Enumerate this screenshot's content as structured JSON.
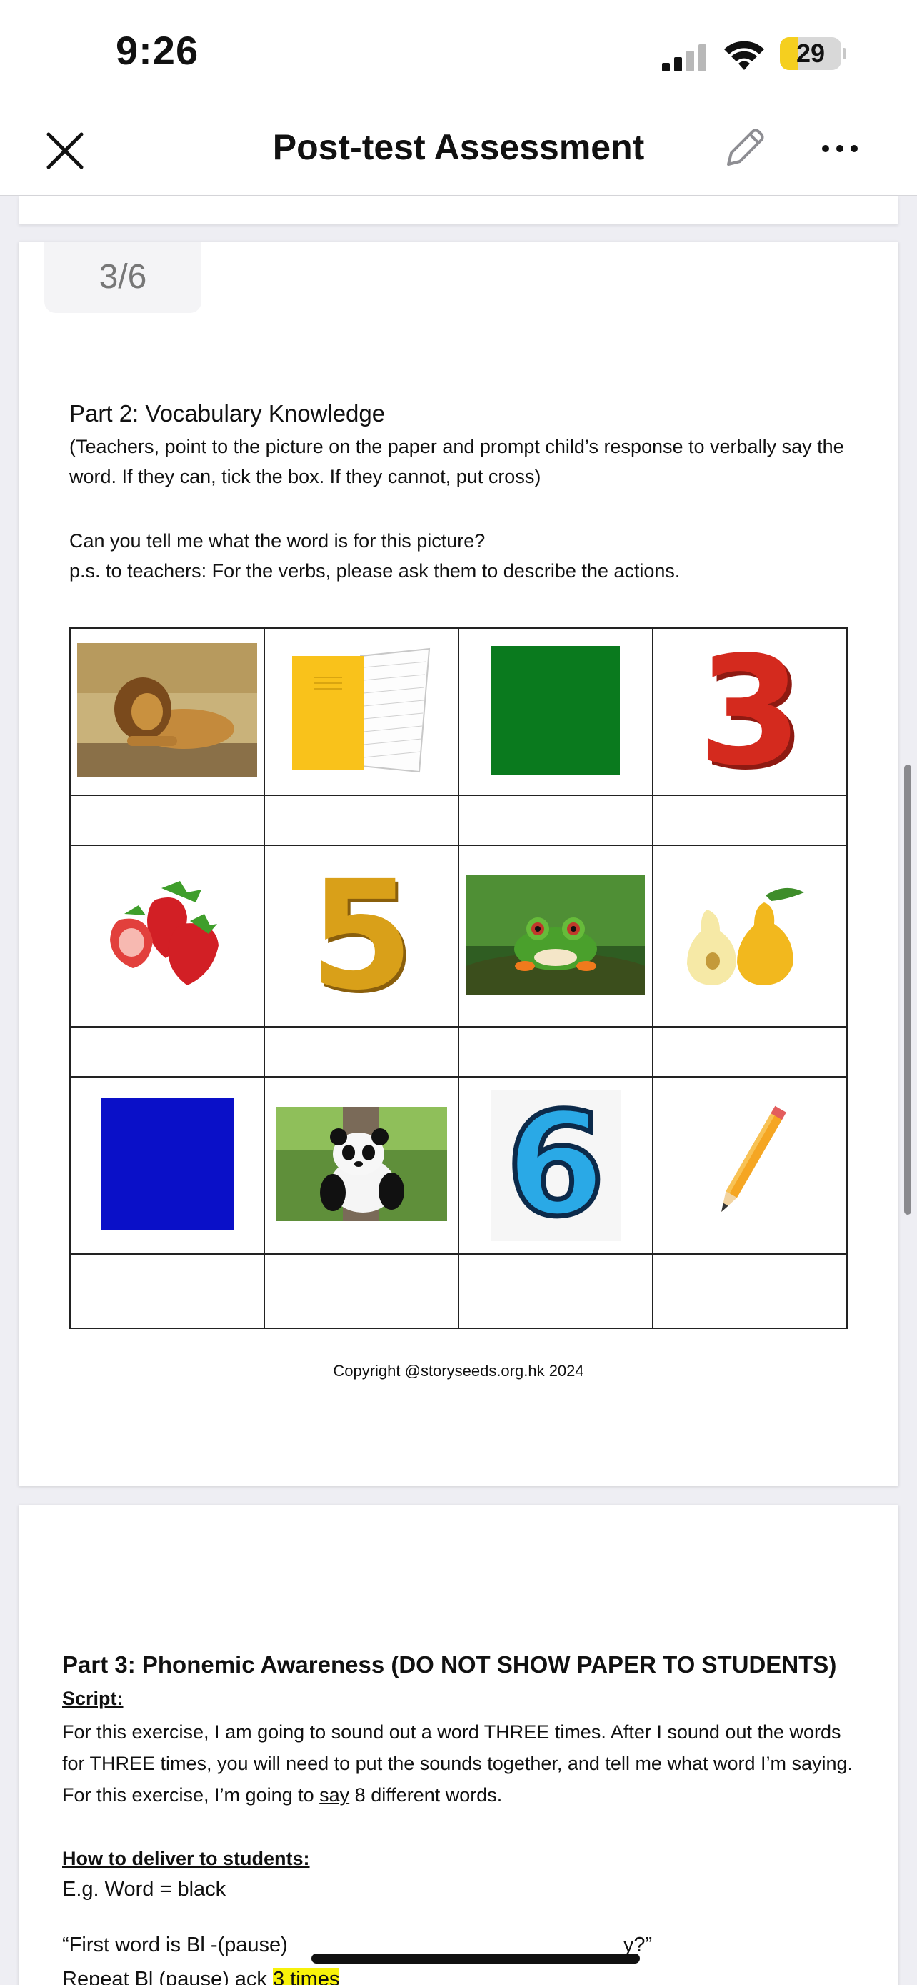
{
  "status_bar": {
    "time": "9:26",
    "battery_level": "29",
    "battery_fraction": 0.29,
    "icons": [
      "cellular-signal-icon",
      "wifi-icon",
      "battery-icon"
    ]
  },
  "nav": {
    "title": "Post-test Assessment",
    "icons": [
      "close-icon",
      "pencil-edit-icon",
      "more-ellipsis-icon"
    ]
  },
  "document": {
    "page_indicator": "3/6",
    "part2": {
      "title": "Part 2: Vocabulary Knowledge",
      "instructions": "(Teachers, point to the picture on the paper and prompt child’s response to verbally say the word. If they can, tick the box. If they cannot, put cross)",
      "question": "Can you tell me what the word is for this picture?",
      "note": "p.s. to teachers: For the verbs, please ask them to describe the actions.",
      "pictures": [
        [
          "lion",
          "yellow-notebook",
          "green-square",
          "number-3"
        ],
        [
          "strawberries",
          "number-5",
          "frog",
          "pears"
        ],
        [
          "blue-square",
          "panda",
          "number-6",
          "pencil"
        ]
      ],
      "picture_text": {
        "three": "3",
        "five": "5",
        "six": "6"
      }
    },
    "copyright": "Copyright @storyseeds.org.hk 2024",
    "part3": {
      "title": "Part 3: Phonemic Awareness (DO NOT SHOW PAPER TO STUDENTS)",
      "script_label": "Script:",
      "body_1": "For this exercise, I am going to sound out a word THREE times. After I sound out the words for THREE times, you will need to put the sounds together, and tell me what word I’m saying. For this exercise, I’m going to ",
      "body_underlined": "say",
      "body_2": " 8 different words.",
      "how_label": "How to deliver to students:",
      "example": "E.g. Word = black",
      "first_word_a": "“First word is Bl -(pause)",
      "first_word_b": "y?”",
      "next_line_a": "Repeat Bl (pause) ack",
      "next_line_highlight": "3 times"
    }
  },
  "colors": {
    "accent_battery": "#f5cf1f",
    "highlight": "#f7f20a",
    "green_square": "#0a7a1e",
    "blue_square": "#0a10c8",
    "number_3": "#d42a1e",
    "number_5": "#d9a019",
    "number_6": "#2aa9e6"
  }
}
